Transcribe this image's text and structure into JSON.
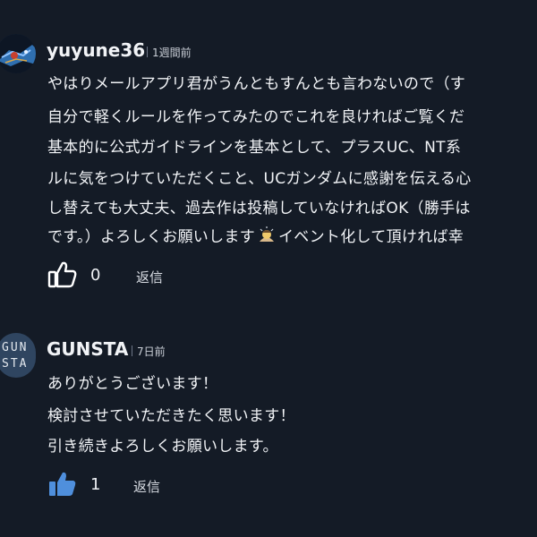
{
  "comments": [
    {
      "author": "yuyune36",
      "time": "1週間前",
      "lines": [
        "やはりメールアプリ君がうんともすんとも言わないので（す",
        "自分で軽くルールを作ってみたのでこれを良ければご覧くだ",
        "基本的に公式ガイドラインを基本として、プラスUC、NT系",
        "ルに気をつけていただくこと、UCガンダムに感謝を伝える心",
        "し替えても大丈夫、過去作は投稿していなければOK（勝手は"
      ],
      "last_line_before": "です。）よろしくお願いします",
      "last_line_after": "イベント化して頂ければ幸",
      "inline_emoji": "person-bowing-emoji",
      "likes": "0",
      "reply": "返信"
    },
    {
      "author": "GUNSTA",
      "time": "7日前",
      "avatar_lines": [
        "GUN",
        "STA"
      ],
      "lines": [
        "ありがとうございます！",
        "検討させていただきたく思います！",
        "引き続きよろしくお願いします。"
      ],
      "likes": "1",
      "reply": "返信"
    }
  ],
  "colors": {
    "background": "#141b26",
    "text": "#f2f4f7",
    "meta": "#c9ced6",
    "like_filled": "#4f8fdc",
    "like_outline": "#ffffff"
  },
  "icons": {
    "like_outline": "thumbs-up-outline-icon",
    "like_filled": "thumbs-up-filled-icon"
  }
}
